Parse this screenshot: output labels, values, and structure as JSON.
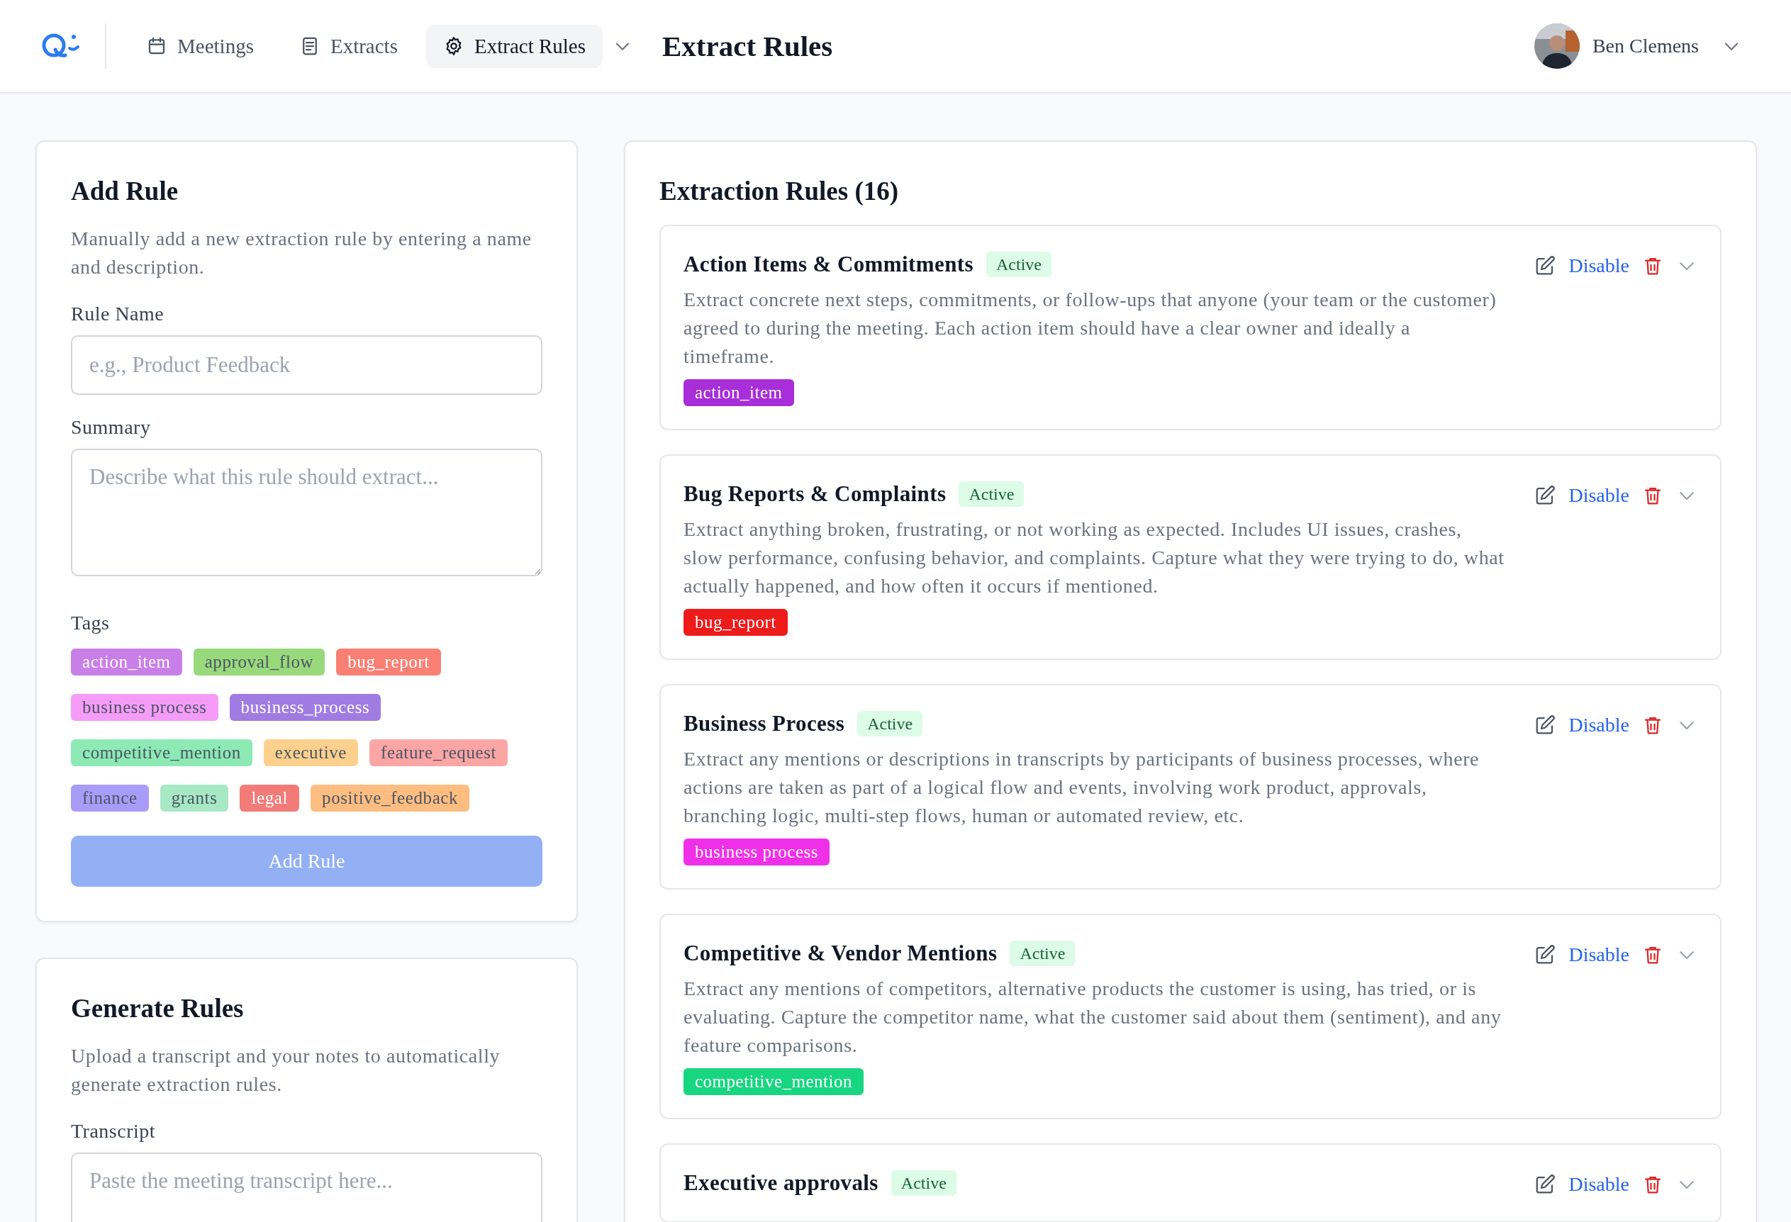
{
  "header": {
    "nav": [
      {
        "label": "Meetings",
        "selected": false
      },
      {
        "label": "Extracts",
        "selected": false
      },
      {
        "label": "Extract Rules",
        "selected": true
      }
    ],
    "page_title": "Extract Rules",
    "user": {
      "name": "Ben Clemens"
    }
  },
  "add_rule": {
    "title": "Add Rule",
    "description": "Manually add a new extraction rule by entering a name and description.",
    "name_label": "Rule Name",
    "name_placeholder": "e.g., Product Feedback",
    "summary_label": "Summary",
    "summary_placeholder": "Describe what this rule should extract...",
    "tags_label": "Tags",
    "tags": [
      {
        "label": "action_item",
        "color": "#c97fe8"
      },
      {
        "label": "approval_flow",
        "color": "#98d97c"
      },
      {
        "label": "bug_report",
        "color": "#fb8074"
      },
      {
        "label": "business process",
        "color": "#f59cf9"
      },
      {
        "label": "business_process",
        "color": "#a07ce2"
      },
      {
        "label": "competitive_mention",
        "color": "#8deab5"
      },
      {
        "label": "executive",
        "color": "#fdd18d"
      },
      {
        "label": "feature_request",
        "color": "#fca5a5"
      },
      {
        "label": "finance",
        "color": "#a99cf9"
      },
      {
        "label": "grants",
        "color": "#a7e9c5"
      },
      {
        "label": "legal",
        "color": "#f27b78"
      },
      {
        "label": "positive_feedback",
        "color": "#fdbd80"
      }
    ],
    "button": "Add Rule",
    "button_disabled": true
  },
  "generate_rules": {
    "title": "Generate Rules",
    "description": "Upload a transcript and your notes to automatically generate extraction rules.",
    "transcript_label": "Transcript",
    "transcript_placeholder": "Paste the meeting transcript here..."
  },
  "rules": {
    "title": "Extraction Rules (16)",
    "items": [
      {
        "name": "Action Items & Commitments",
        "status": "Active",
        "active": true,
        "action": "Disable",
        "description": "Extract concrete next steps, commitments, or follow-ups that anyone (your team or the customer) agreed to during the meeting. Each action item should have a clear owner and ideally a timeframe.",
        "tag": {
          "label": "action_item",
          "color": "#a72ed9"
        }
      },
      {
        "name": "Bug Reports & Complaints",
        "status": "Active",
        "active": true,
        "action": "Disable",
        "description": "Extract anything broken, frustrating, or not working as expected. Includes UI issues, crashes, slow performance, confusing behavior, and complaints. Capture what they were trying to do, what actually happened, and how often it occurs if mentioned.",
        "tag": {
          "label": "bug_report",
          "color": "#ee1b1b"
        }
      },
      {
        "name": "Business Process",
        "status": "Active",
        "active": true,
        "action": "Disable",
        "description": "Extract any mentions or descriptions in transcripts by participants of business processes, where actions are taken as part of a logical flow and events, involving work product, approvals, branching logic, multi-step flows, human or automated review, etc.",
        "tag": {
          "label": "business process",
          "color": "#f030e8"
        }
      },
      {
        "name": "Competitive & Vendor Mentions",
        "status": "Active",
        "active": true,
        "action": "Disable",
        "description": "Extract any mentions of competitors, alternative products the customer is using, has tried, or is evaluating. Capture the competitor name, what the customer said about them (sentiment), and any feature comparisons.",
        "tag": {
          "label": "competitive_mention",
          "color": "#17d67f"
        }
      },
      {
        "name": "Executive approvals",
        "status": "Active",
        "active": true,
        "action": "Disable"
      }
    ]
  }
}
